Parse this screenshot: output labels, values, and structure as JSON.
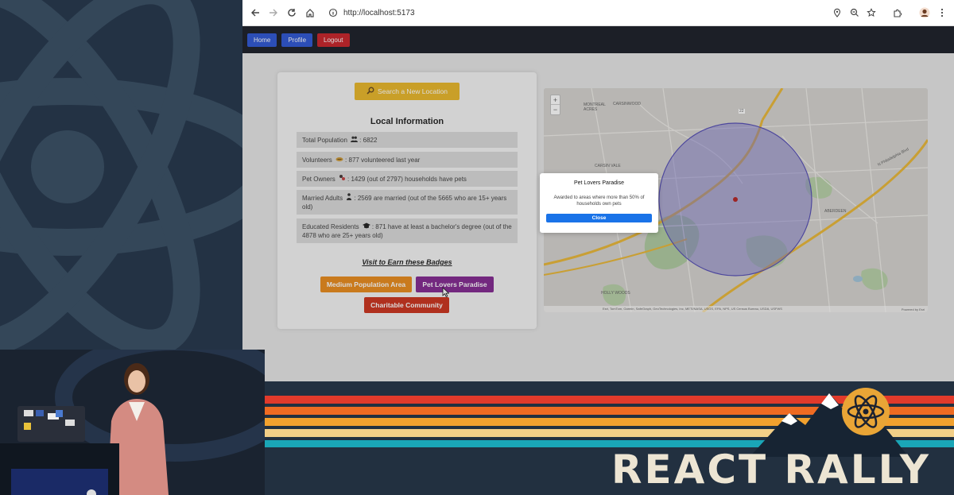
{
  "browser": {
    "url": "http://localhost:5173",
    "icons": [
      "back-arrow-icon",
      "forward-arrow-icon",
      "reload-icon",
      "home-icon",
      "info-icon",
      "location-pin-icon",
      "zoom-icon",
      "star-icon",
      "extensions-icon",
      "profile-avatar",
      "more-menu-icon"
    ]
  },
  "nav": {
    "home": "Home",
    "profile": "Profile",
    "logout": "Logout"
  },
  "info": {
    "search_button": "Search a New Location",
    "title": "Local Information",
    "rows": [
      {
        "label": "Total Population",
        "text": ": 6822"
      },
      {
        "label": "Volunteers",
        "text": ": 877 volunteered last year"
      },
      {
        "label": "Pet Owners",
        "text": ": 1429 (out of 2797) households have pets"
      },
      {
        "label": "Married Adults",
        "text": ": 2569 are married (out of the 5665 who are 15+ years old)"
      },
      {
        "label": "Educated Residents",
        "text": ": 871 have at least a bachelor's degree (out of the 4878 who are 25+ years old)"
      }
    ],
    "visit_link": "Visit to Earn these Badges",
    "badges": [
      {
        "label": "Medium Population Area",
        "color": "#e8830c"
      },
      {
        "label": "Pet Lovers Paradise",
        "color": "#7a1a8a"
      },
      {
        "label": "Charitable Community",
        "color": "#c8240e"
      }
    ]
  },
  "map": {
    "zoom_in": "+",
    "zoom_out": "−",
    "labels": [
      "MONTREAL ACRES",
      "CARSINWOOD",
      "CARSIN VALE",
      "ABERDEEN",
      "N Philadelphia Blvd",
      "HOLLY WOODS"
    ],
    "road_number": "22",
    "attribution": "Esri, TomTom, Garmin, SafeGraph, GeoTechnologies, Inc, METI/NASA, USGS, EPA, NPS, US Census Bureau, USDA, USFWS",
    "powered_by": "Powered by Esri"
  },
  "modal": {
    "title": "Pet Lovers Paradise",
    "description": "Awarded to areas where more than 50% of households own pets",
    "close": "Close"
  },
  "conference": {
    "title": "REACT RALLY"
  }
}
